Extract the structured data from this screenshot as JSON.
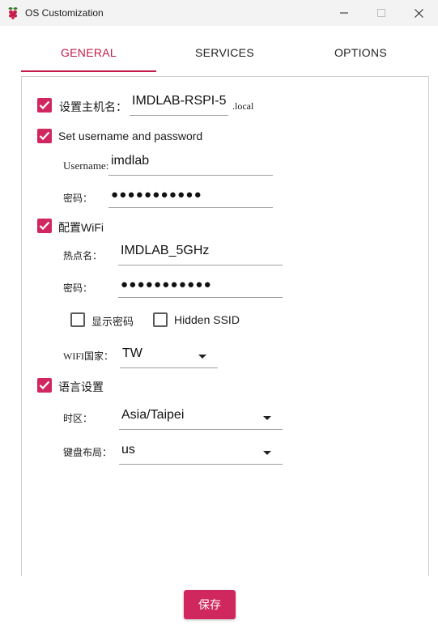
{
  "window": {
    "title": "OS Customization",
    "accent": "#d0275f"
  },
  "tabs": {
    "general": "GENERAL",
    "services": "SERVICES",
    "options": "OPTIONS",
    "active": "GENERAL"
  },
  "general": {
    "hostname": {
      "checked": true,
      "label": "设置主机名：",
      "value": "IMDLAB-RSPI-5",
      "suffix": ".local"
    },
    "user": {
      "checked": true,
      "label": "Set username and password",
      "username_label": "Username:",
      "username_value": "imdlab",
      "password_label": "密码：",
      "password_value": "●●●●●●●●●●●"
    },
    "wifi": {
      "checked": true,
      "label": "配置WiFi",
      "ssid_label": "热点名：",
      "ssid_value": "IMDLAB_5GHz",
      "password_label": "密码：",
      "password_value": "●●●●●●●●●●●",
      "show_password_label": "显示密码",
      "show_password_checked": false,
      "hidden_ssid_label": "Hidden SSID",
      "hidden_ssid_checked": false,
      "country_label": "WIFI国家：",
      "country_value": "TW"
    },
    "locale": {
      "checked": true,
      "label": "语言设置",
      "timezone_label": "时区：",
      "timezone_value": "Asia/Taipei",
      "keyboard_label": "键盘布局：",
      "keyboard_value": "us"
    }
  },
  "footer": {
    "save_label": "保存"
  }
}
